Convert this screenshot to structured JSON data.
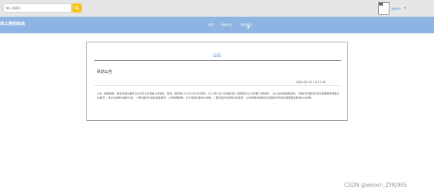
{
  "search": {
    "placeholder": "输入关键词"
  },
  "user": {
    "name": "admin"
  },
  "app": {
    "title": "线上竞拍系统"
  },
  "nav": {
    "items": [
      {
        "label": "首页"
      },
      {
        "label": "系统公告"
      },
      {
        "label": "拍卖物品"
      }
    ]
  },
  "colors": {
    "topbar": "#e6e6e6",
    "navbar": "#8db4e2",
    "search_button": "#f6c20a",
    "accent": "#4a8fd8"
  },
  "icons": {
    "search": "search-icon",
    "caret": "caret-down-icon"
  },
  "announcement": {
    "section_title": "公告",
    "title": "网站公告",
    "time": "2024-03-31 16:21:49",
    "content": "公告，是指政府、团体对重大事件当众正式公布或者公开宣告，宣布。国务院2012年4月16日发布，2012年7月1日起施行的《党政机关公文处理工作条例》，对公告的使用表述为：“适用于向国内外宣布重要事项或者法定事项”。其中包含两方面的内容：一是向国内外宣布重要事项，公布依据政策，法令采取的重大行动等；二是向国内外宣布法定事项，公布依据法律规定告知国内外的有关重要规定和重大行动等。"
  },
  "watermark": "CSDN @weixin_ZYKJ985"
}
